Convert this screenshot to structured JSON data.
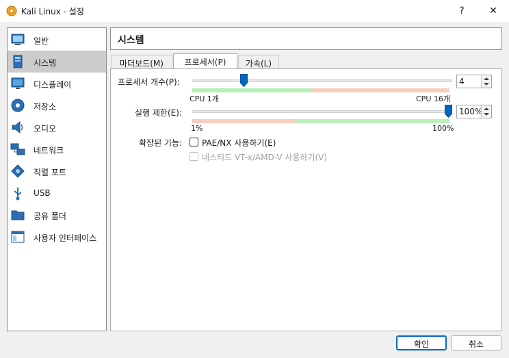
{
  "window": {
    "title": "Kali Linux - 설정",
    "help": "?",
    "close": "✕"
  },
  "sidebar": {
    "items": [
      {
        "label": "일반",
        "icon": "general-icon",
        "selected": false
      },
      {
        "label": "시스템",
        "icon": "system-icon",
        "selected": true
      },
      {
        "label": "디스플레이",
        "icon": "display-icon",
        "selected": false
      },
      {
        "label": "저장소",
        "icon": "storage-icon",
        "selected": false
      },
      {
        "label": "오디오",
        "icon": "audio-icon",
        "selected": false
      },
      {
        "label": "네트워크",
        "icon": "network-icon",
        "selected": false
      },
      {
        "label": "직렬 포트",
        "icon": "serial-port-icon",
        "selected": false
      },
      {
        "label": "USB",
        "icon": "usb-icon",
        "selected": false
      },
      {
        "label": "공유 폴더",
        "icon": "shared-folder-icon",
        "selected": false
      },
      {
        "label": "사용자 인터페이스",
        "icon": "user-interface-icon",
        "selected": false
      }
    ]
  },
  "section_title": "시스템",
  "tabs": [
    {
      "label": "마더보드(M)",
      "active": false
    },
    {
      "label": "프로세서(P)",
      "active": true
    },
    {
      "label": "가속(L)",
      "active": false
    }
  ],
  "processor": {
    "label": "프로세서 개수(P):",
    "value": "4",
    "min_label": "CPU 1개",
    "max_label": "CPU 16개",
    "min": 1,
    "max": 16,
    "current": 4
  },
  "execution_cap": {
    "label": "실행 제한(E):",
    "value": "100%",
    "min_label": "1%",
    "max_label": "100%",
    "min": 1,
    "max": 100,
    "current": 100
  },
  "extended_features": {
    "label": "확장된 기능:",
    "pae": {
      "label": "PAE/NX 사용하기(E)",
      "checked": false,
      "enabled": true
    },
    "nested": {
      "label": "네스티드 VT-x/AMD-V 사용하기(V)",
      "checked": false,
      "enabled": false
    }
  },
  "buttons": {
    "ok": "확인",
    "cancel": "취소"
  },
  "colors": {
    "accent": "#0067c0",
    "good": "#b9f0b9",
    "warn": "#f9cdbf",
    "selected_bg": "#cccccc"
  }
}
